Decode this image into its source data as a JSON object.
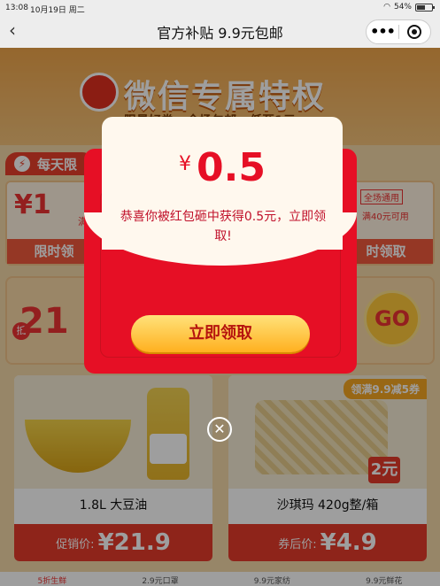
{
  "status_bar": {
    "time": "13:08",
    "date": "10月19日 周二",
    "battery": "54%"
  },
  "nav": {
    "title": "官方补贴 9.9元包邮"
  },
  "banner": {
    "title": "微信专属特权",
    "subtitle": "限量好券 · 全场包邮 · 低至1元"
  },
  "daily_section": {
    "label": "每天限"
  },
  "coupons": {
    "left": {
      "amount": "¥1",
      "cond": "满",
      "band": "限时领"
    },
    "right": {
      "tag": "全场通用",
      "cond": "满40元可用",
      "band": "时领取"
    }
  },
  "promo": {
    "number": "21",
    "stamp": "抵",
    "go_label": "GO"
  },
  "products": [
    {
      "name": "1.8L 大豆油",
      "price_label": "促销价:",
      "price": "¥21.9"
    },
    {
      "name": "沙琪玛 420g整/箱",
      "price_label": "券后价:",
      "price": "¥4.9",
      "ribbon": "领满9.9减5券",
      "badge": "2元"
    }
  ],
  "bottom_tabs": [
    "5折生鲜",
    "2.9元口罩",
    "9.9元家纺",
    "9.9元鲜花"
  ],
  "modal": {
    "currency": "¥",
    "amount": "0.5",
    "message": "恭喜你被红包砸中获得0.5元，立即领取!",
    "claim_label": "立即领取",
    "close_glyph": "✕"
  },
  "colors": {
    "envelope_red": "#e60f25",
    "button_gold": "#ffb01f",
    "accent_red": "#e33333"
  }
}
